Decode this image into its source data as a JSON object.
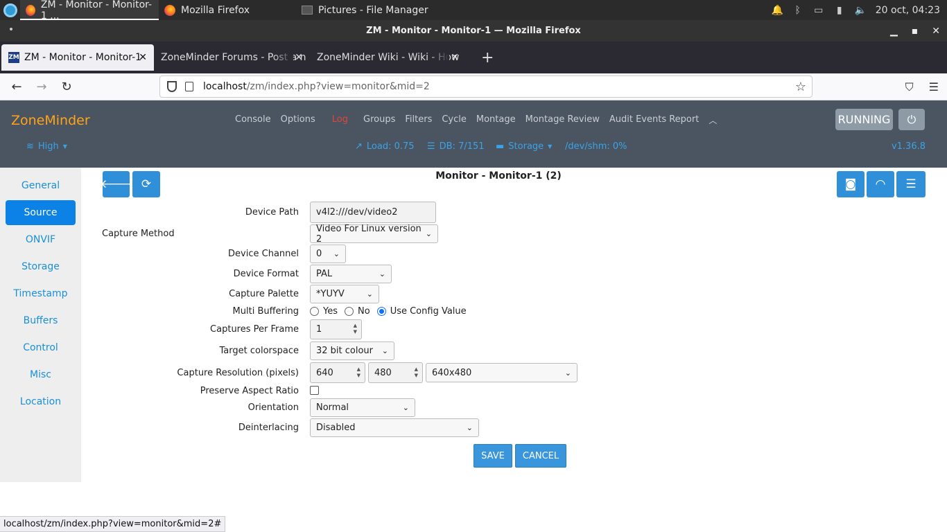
{
  "taskbar": {
    "tasks": [
      {
        "label": "ZM - Monitor - Monitor-1 ...",
        "icon": "firefox-icon"
      },
      {
        "label": "Mozilla Firefox",
        "icon": "firefox-icon"
      },
      {
        "label": "Pictures - File Manager",
        "icon": "file-manager-icon"
      }
    ],
    "clock": "20 oct, 04:23"
  },
  "window": {
    "title": "ZM - Monitor - Monitor-1 — Mozilla Firefox"
  },
  "browser": {
    "tabs": [
      {
        "label": "ZM - Monitor - Monitor-1"
      },
      {
        "label": "ZoneMinder Forums - Post a n"
      },
      {
        "label": "ZoneMinder Wiki - Wiki - How"
      }
    ],
    "url": {
      "host": "localhost",
      "path": "/zm/index.php?view=monitor&mid=2"
    }
  },
  "zm": {
    "logo": "ZoneMinder",
    "menu": [
      "Console",
      "Options",
      "Log",
      "Groups",
      "Filters",
      "Cycle",
      "Montage",
      "Montage Review",
      "Audit Events Report"
    ],
    "state": "RUNNING",
    "bandwidth": "High",
    "load": "Load: 0.75",
    "db": "DB: 7/151",
    "storage": "Storage",
    "shm": "/dev/shm: 0%",
    "version": "v1.36.8"
  },
  "sidebar": {
    "items": [
      "General",
      "Source",
      "ONVIF",
      "Storage",
      "Timestamp",
      "Buffers",
      "Control",
      "Misc",
      "Location"
    ],
    "active": "Source"
  },
  "form": {
    "title": "Monitor - Monitor-1 (2)",
    "device_path": {
      "label": "Device Path",
      "value": "v4l2:///dev/video2"
    },
    "capture_method": {
      "label": "Capture Method",
      "value": "Video For Linux version 2"
    },
    "device_channel": {
      "label": "Device Channel",
      "value": "0"
    },
    "device_format": {
      "label": "Device Format",
      "value": "PAL"
    },
    "capture_palette": {
      "label": "Capture Palette",
      "value": "*YUYV"
    },
    "multi_buffering": {
      "label": "Multi Buffering",
      "options": [
        "Yes",
        "No",
        "Use Config Value"
      ],
      "selected": "Use Config Value"
    },
    "captures_per_frame": {
      "label": "Captures Per Frame",
      "value": "1"
    },
    "target_colorspace": {
      "label": "Target colorspace",
      "value": "32 bit colour"
    },
    "capture_resolution": {
      "label": "Capture Resolution (pixels)",
      "width": "640",
      "height": "480",
      "preset": "640x480"
    },
    "preserve_aspect": {
      "label": "Preserve Aspect Ratio",
      "checked": false
    },
    "orientation": {
      "label": "Orientation",
      "value": "Normal"
    },
    "deinterlacing": {
      "label": "Deinterlacing",
      "value": "Disabled"
    },
    "save_label": "SAVE",
    "cancel_label": "CANCEL"
  },
  "statusbar": {
    "text": "localhost/zm/index.php?view=monitor&mid=2#"
  },
  "colors": {
    "accent": "#0d82e6",
    "header_bg": "#4a5561",
    "logo": "#ffa31a",
    "log_link": "#e0453c"
  }
}
